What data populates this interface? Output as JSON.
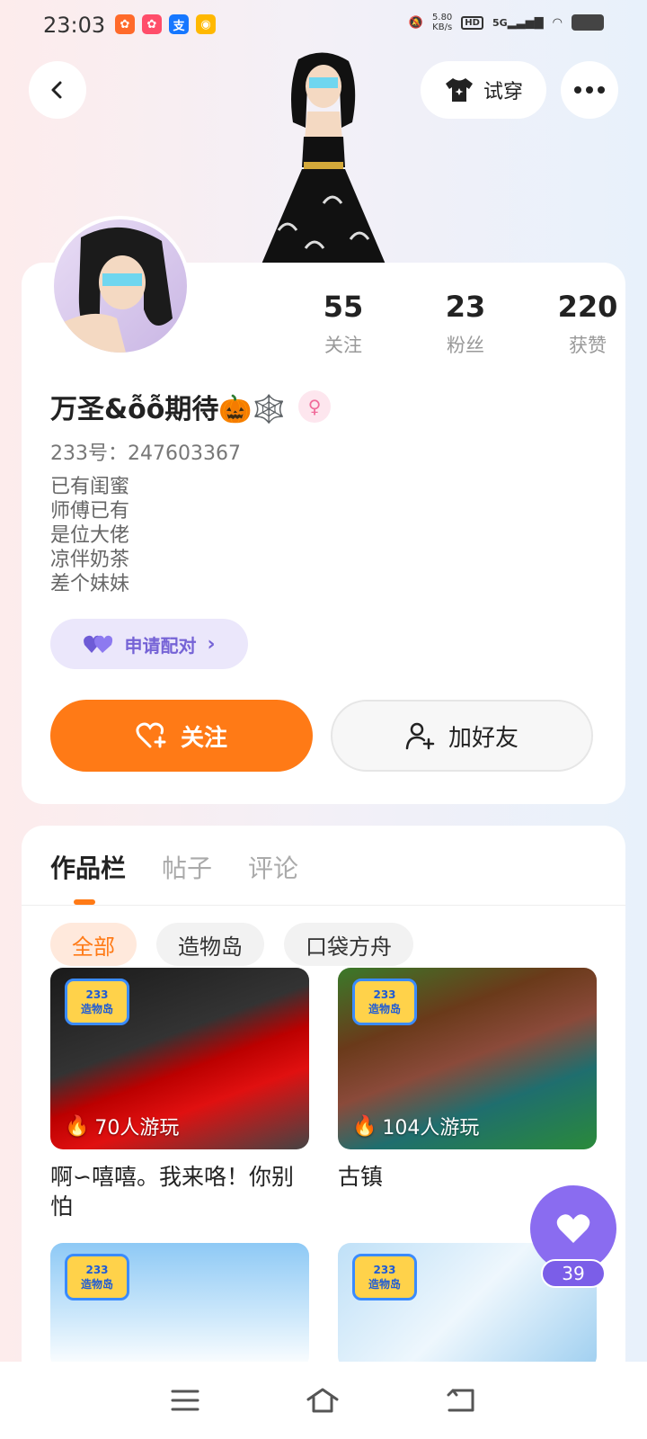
{
  "status_bar": {
    "time": "23:03",
    "net_speed_value": "5.80",
    "net_speed_unit": "KB/s",
    "hd": "HD",
    "signal": "5G",
    "notification_icons": [
      "app-icon-orange",
      "app-icon-red",
      "alipay-icon",
      "weibo-icon"
    ]
  },
  "header": {
    "back_icon": "chevron-left-icon",
    "try_on_label": "试穿",
    "try_on_icon": "shirt-icon",
    "more_icon": "more-dots-icon"
  },
  "profile": {
    "stats": [
      {
        "value": "55",
        "label": "关注"
      },
      {
        "value": "23",
        "label": "粉丝"
      },
      {
        "value": "220",
        "label": "获赞"
      }
    ],
    "nickname": "万圣&ỗỗ期待🎃🕸️",
    "gender_symbol": "♀",
    "uid": "233号：247603367",
    "bio_lines": [
      "已有闺蜜",
      "师傅已有",
      "是位大佬",
      "凉伴奶茶",
      "差个妹妹"
    ],
    "pair_button": "申请配对",
    "follow_button": "关注",
    "add_friend_button": "加好友"
  },
  "works": {
    "tabs": [
      "作品栏",
      "帖子",
      "评论"
    ],
    "active_tab": "作品栏",
    "filters": [
      "全部",
      "造物岛",
      "口袋方舟"
    ],
    "active_filter": "全部",
    "badge_line1": "233",
    "badge_line2": "造物岛",
    "items": [
      {
        "players": "70人游玩",
        "title": "啊∽嘻嘻。我来咯！你别怕"
      },
      {
        "players": "104人游玩",
        "title": "古镇"
      },
      {
        "players": "",
        "title": ""
      },
      {
        "players": "",
        "title": ""
      }
    ]
  },
  "floating_like": {
    "count": "39"
  },
  "colors": {
    "accent_orange": "#ff7a16",
    "pair_purple": "#7563d6",
    "like_purple": "#8a6cf0"
  }
}
